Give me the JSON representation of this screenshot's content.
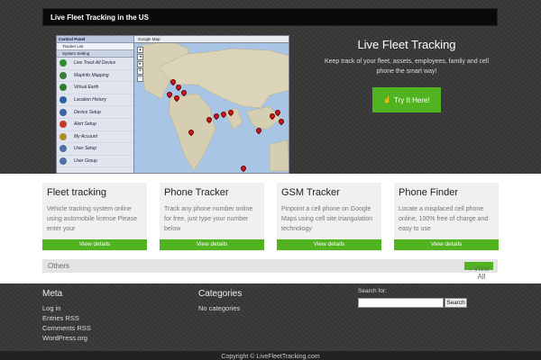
{
  "header": {
    "title": "Live Fleet Tracking in the US"
  },
  "screenshot": {
    "panel_title": "Control Panel",
    "panel_sub": "Tracker List",
    "panel_sub2": "System Setting",
    "map_title": "Google Map",
    "items": [
      {
        "label": "Live Track All Device",
        "color": "#2e8b2e"
      },
      {
        "label": "MapInfo Mapping",
        "color": "#3a7a3a"
      },
      {
        "label": "Virtual Earth",
        "color": "#2f7d2f"
      },
      {
        "label": "Location History",
        "color": "#2f5fa8"
      },
      {
        "label": "Device Setup",
        "color": "#3c62a0"
      },
      {
        "label": "Alert Setup",
        "color": "#c13b2b"
      },
      {
        "label": "My Account",
        "color": "#b08a2a"
      },
      {
        "label": "User Setup",
        "color": "#4e6fa8"
      },
      {
        "label": "User Group",
        "color": "#4e6fa8"
      }
    ]
  },
  "hero": {
    "title": "Live Fleet Tracking",
    "subtitle": "Keep track of your fleet, assets, employees, family and cell phone the smart way!",
    "button": "Try It Here!"
  },
  "cards": [
    {
      "title": "Fleet tracking",
      "text": "Vehicle tracking system online using automobile license Please enter your",
      "button": "View details"
    },
    {
      "title": "Phone Tracker",
      "text": "Track any phone number online for free, just type your number below",
      "button": "View details"
    },
    {
      "title": "GSM Tracker",
      "text": "Pinpoint a cell phone on Google Maps using cell site triangulation technology",
      "button": "View details"
    },
    {
      "title": "Phone Finder",
      "text": "Locate a misplaced cell phone online, 100% free of charge and easy to use",
      "button": "View details"
    }
  ],
  "others": {
    "label": "Others",
    "button": "View All"
  },
  "footer": {
    "meta_title": "Meta",
    "meta_links": [
      "Log in",
      "Entries RSS",
      "Comments RSS",
      "WordPress.org"
    ],
    "categories_title": "Categories",
    "categories_text": "No categories",
    "search_label": "Search for:",
    "search_button": "Search",
    "copyright": "Copyright © LiveFleetTracking.com"
  },
  "colors": {
    "accent": "#52b320",
    "topbar": "#0a0a0a"
  }
}
